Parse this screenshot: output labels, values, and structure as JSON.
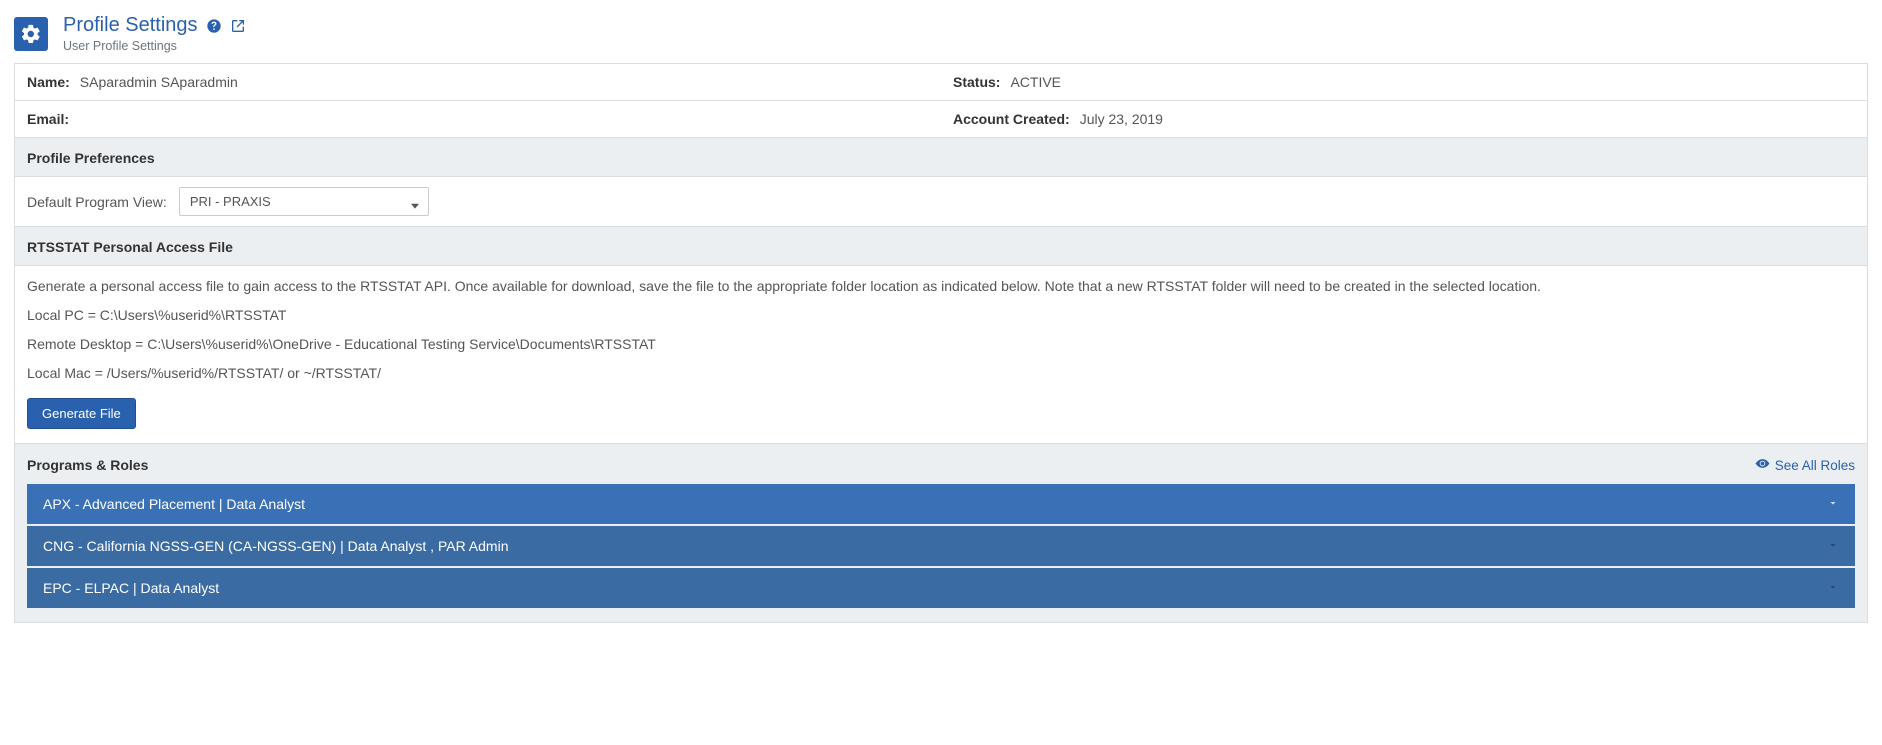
{
  "header": {
    "title": "Profile Settings",
    "subtitle": "User Profile Settings"
  },
  "info": {
    "name_label": "Name:",
    "name_value": "SAparadmin  SAparadmin",
    "status_label": "Status:",
    "status_value": "ACTIVE",
    "email_label": "Email:",
    "email_value": "",
    "created_label": "Account Created:",
    "created_value": "July 23, 2019"
  },
  "preferences": {
    "heading": "Profile Preferences",
    "program_view_label": "Default Program View:",
    "program_view_value": "PRI - PRAXIS"
  },
  "rtsstat": {
    "heading": "RTSSTAT Personal Access File",
    "desc": "Generate a personal access file to gain access to the RTSSTAT API. Once available for download, save the file to the appropriate folder location as indicated below. Note that a new RTSSTAT folder will need to be created in the selected location.",
    "path_local_pc": "Local PC = C:\\Users\\%userid%\\RTSSTAT",
    "path_remote": "Remote Desktop = C:\\Users\\%userid%\\OneDrive - Educational Testing Service\\Documents\\RTSSTAT",
    "path_mac": "Local Mac = /Users/%userid%/RTSSTAT/ or ~/RTSSTAT/",
    "generate_label": "Generate File"
  },
  "roles": {
    "heading": "Programs & Roles",
    "see_all_label": "See All Roles",
    "items": [
      "APX - Advanced Placement | Data Analyst",
      "CNG - California NGSS-GEN (CA-NGSS-GEN) | Data Analyst , PAR Admin",
      "EPC - ELPAC | Data Analyst"
    ]
  }
}
